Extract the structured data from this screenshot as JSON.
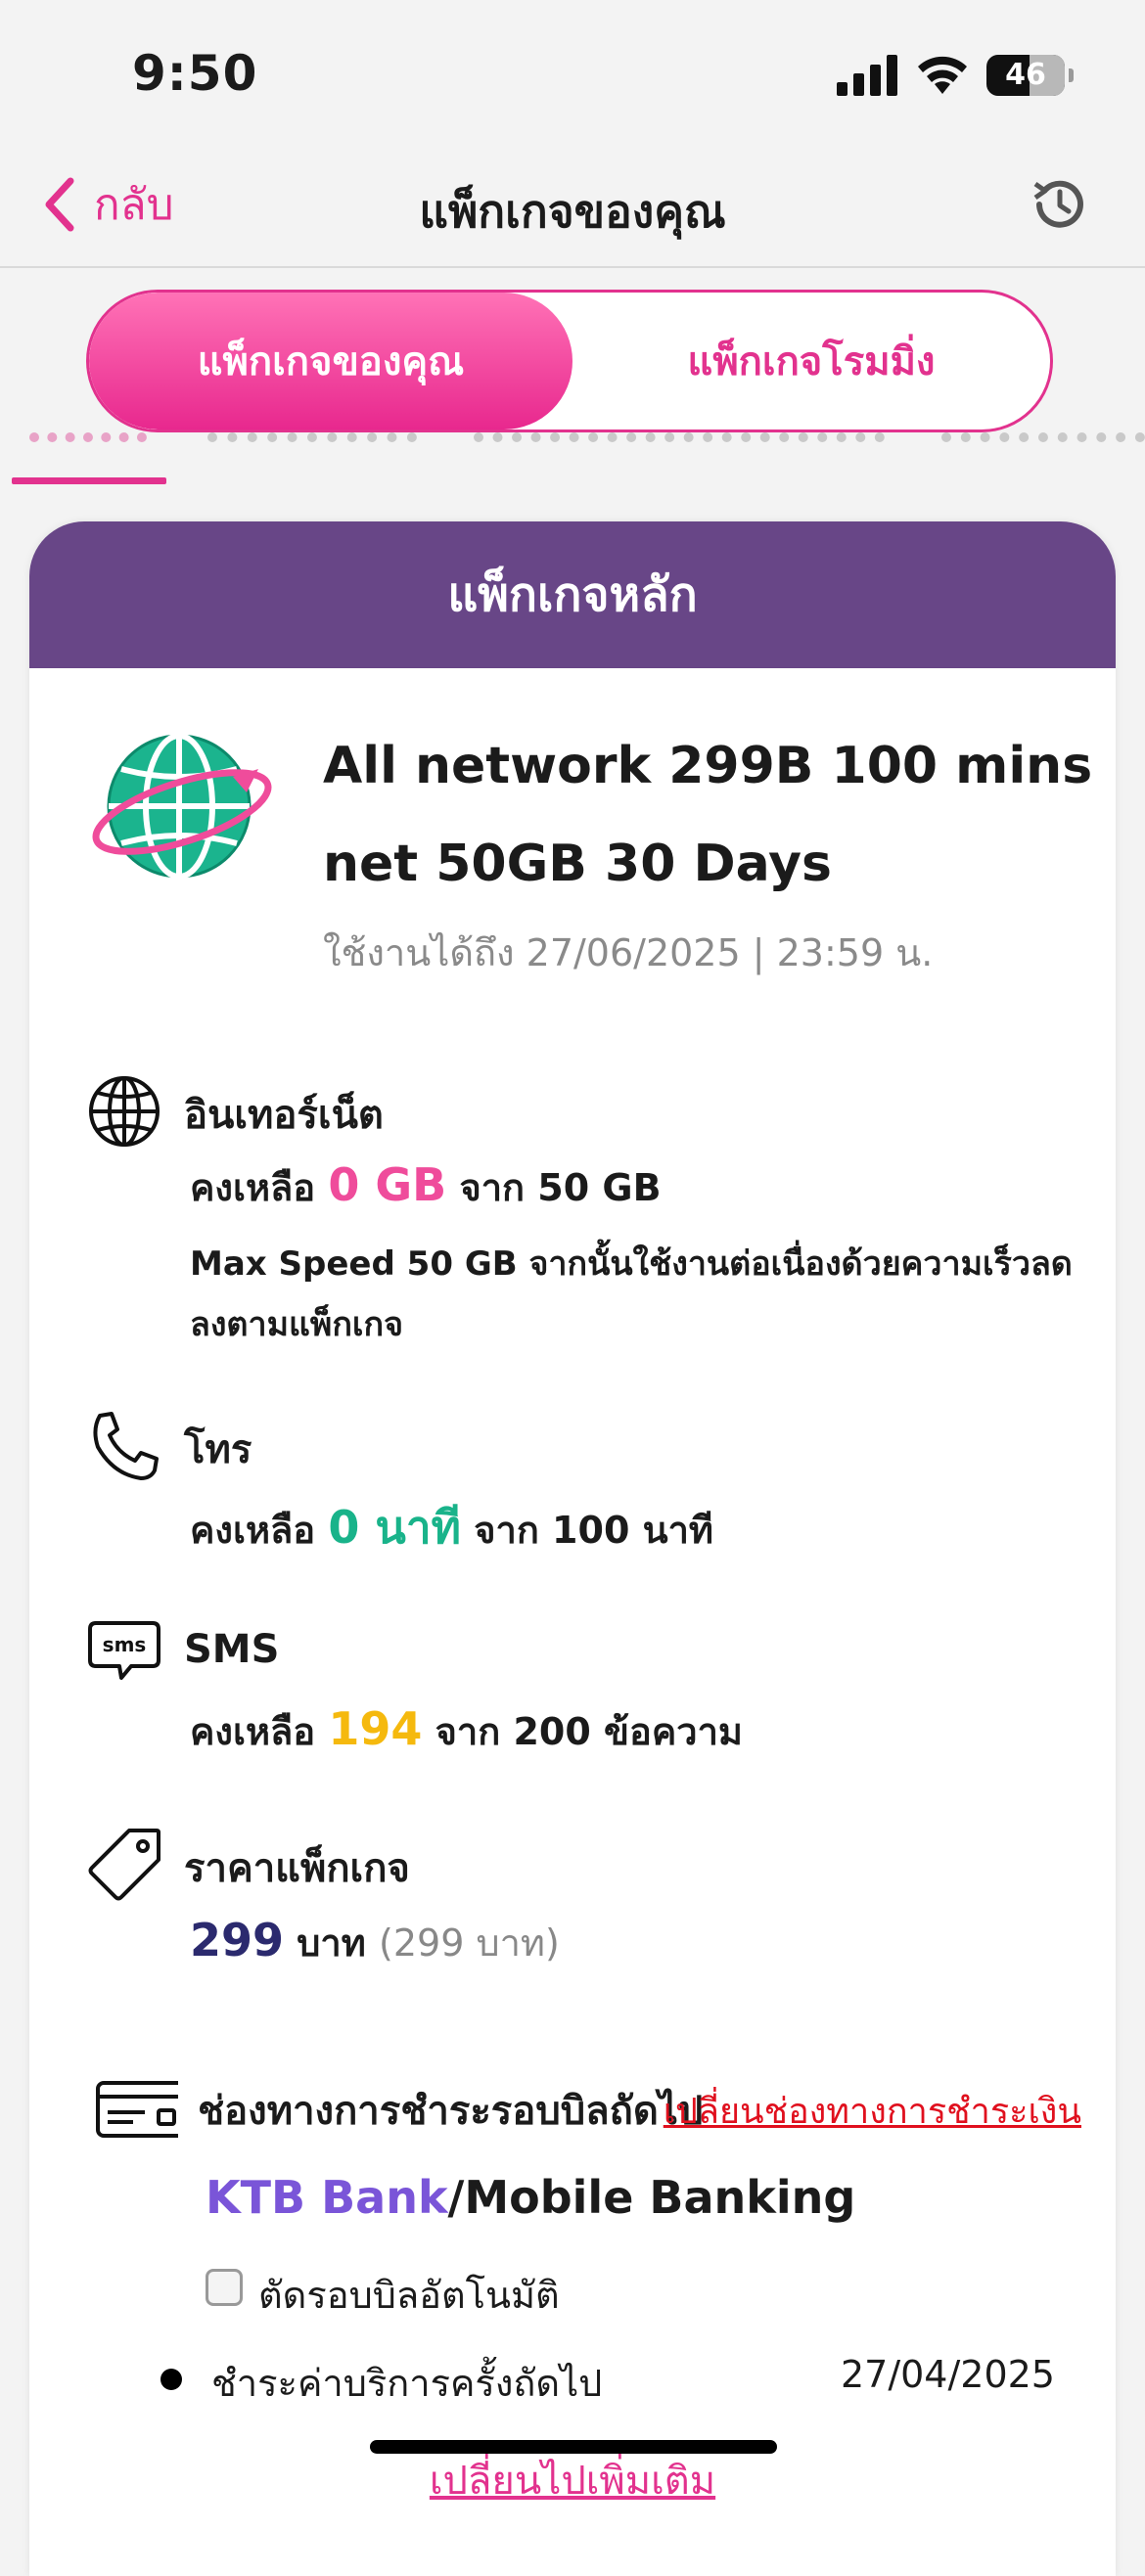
{
  "status_bar": {
    "time": "9:50",
    "battery": "46"
  },
  "nav": {
    "back_label": "กลับ",
    "title": "แพ็กเกจของคุณ"
  },
  "segments": {
    "active": "แพ็กเกจของคุณ",
    "inactive": "แพ็กเกจโรมมิ่ง"
  },
  "card": {
    "header": "แพ็กเกจหลัก",
    "package_name_line1": "All network 299B 100 mins",
    "package_name_line2": "net 50GB 30 Days",
    "validity": "ใช้งานได้ถึง 27/06/2025 | 23:59 น."
  },
  "internet": {
    "title": "อินเทอร์เน็ต",
    "prefix": "คงเหลือ",
    "value": "0 GB",
    "suffix": "จาก 50 GB",
    "note_line1": "Max Speed 50 GB จากนั้นใช้งานต่อเนื่องด้วยความเร็วลด",
    "note_line2": "ลงตามแพ็กเกจ"
  },
  "call": {
    "title": "โทร",
    "prefix": "คงเหลือ",
    "value": "0 นาที",
    "suffix": "จาก 100 นาที"
  },
  "sms": {
    "title": "SMS",
    "icon_text": "sms",
    "prefix": "คงเหลือ",
    "value": "194",
    "suffix": "จาก 200 ข้อความ"
  },
  "price": {
    "title": "ราคาแพ็กเกจ",
    "value": "299",
    "unit": "บาท",
    "detail": "(299 บาท)"
  },
  "payment": {
    "title": "ช่องทางการชำระรอบบิลถัดไป",
    "change_link": "เปลี่ยนช่องทางการชำระเงิน",
    "bank": "KTB Bank",
    "method": "/Mobile Banking",
    "auto_label": "ตัดรอบบิลอัตโนมัติ",
    "auto_checked": false,
    "next_label": "ชำระค่าบริการครั้งถัดไป",
    "next_date": "27/04/2025",
    "more_link": "เปลี่ยนไปเพิ่มเติม"
  },
  "colors": {
    "brand_pink": "#e2328e",
    "header_purple": "#684687",
    "data_pink": "#ef4c9b",
    "call_teal": "#19b38a",
    "sms_yellow": "#f5b90e",
    "price_navy": "#2b2a6e",
    "bank_purple": "#7a55d8",
    "link_red": "#e0101e"
  }
}
